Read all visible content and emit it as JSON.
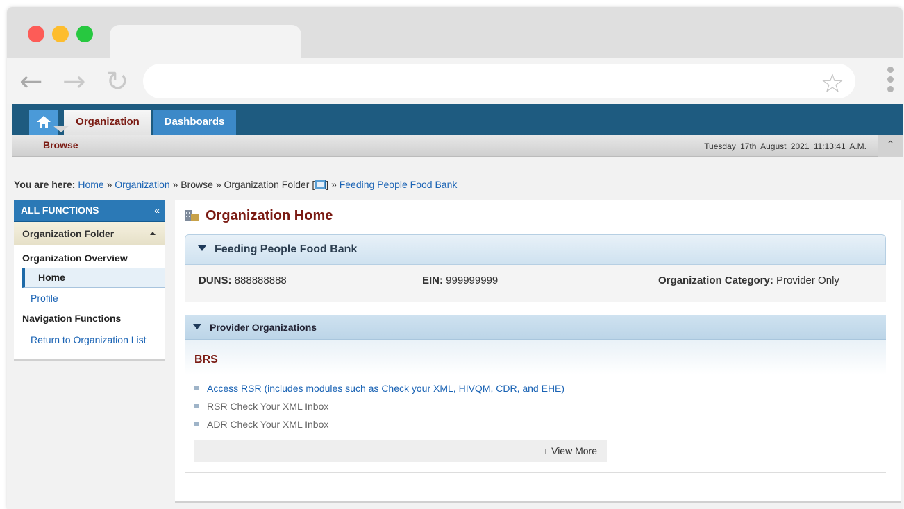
{
  "browser": {
    "back_icon": "back-arrow-icon",
    "forward_icon": "forward-arrow-icon",
    "reload_icon": "reload-icon",
    "bookmark_icon": "star-icon",
    "menu_icon": "kebab-menu-icon",
    "url": ""
  },
  "topnav": {
    "home_icon": "home-icon",
    "tabs": [
      "Organization",
      "Dashboards"
    ]
  },
  "subnav": {
    "active": "Browse",
    "datetime": "Tuesday 17th August  2021 11:13:41 A.M.",
    "collapse_icon": "double-chevron-up-icon"
  },
  "breadcrumb": {
    "label": "You are here:",
    "items": [
      "Home",
      "Organization",
      "Browse",
      "Organization Folder",
      "Feeding People Food Bank"
    ],
    "separator": "»",
    "folder_open": "[",
    "folder_close": "]"
  },
  "sidebar": {
    "title": "ALL FUNCTIONS",
    "collapse_glyph": "«",
    "folder_label": "Organization Folder",
    "overview_label": "Organization Overview",
    "items": [
      "Home",
      "Profile"
    ],
    "nav_label": "Navigation Functions",
    "nav_items": [
      "Return to Organization List"
    ]
  },
  "main": {
    "title": "Organization Home",
    "org": {
      "name": "Feeding People Food Bank",
      "duns_label": "DUNS:",
      "duns": "888888888",
      "ein_label": "EIN:",
      "ein": "999999999",
      "category_label": "Organization Category:",
      "category": "Provider Only"
    },
    "provider": {
      "header": "Provider Organizations",
      "group": "BRS",
      "links": [
        "Access RSR (includes modules such as Check your XML, HIVQM, CDR, and EHE)",
        "RSR Check Your XML Inbox",
        "ADR Check Your XML Inbox"
      ],
      "view_more": "+ View More"
    }
  },
  "colors": {
    "header_blue": "#1e5b80",
    "accent_blue": "#3c89c8",
    "maroon": "#7a1a12",
    "link": "#1a63b4"
  }
}
